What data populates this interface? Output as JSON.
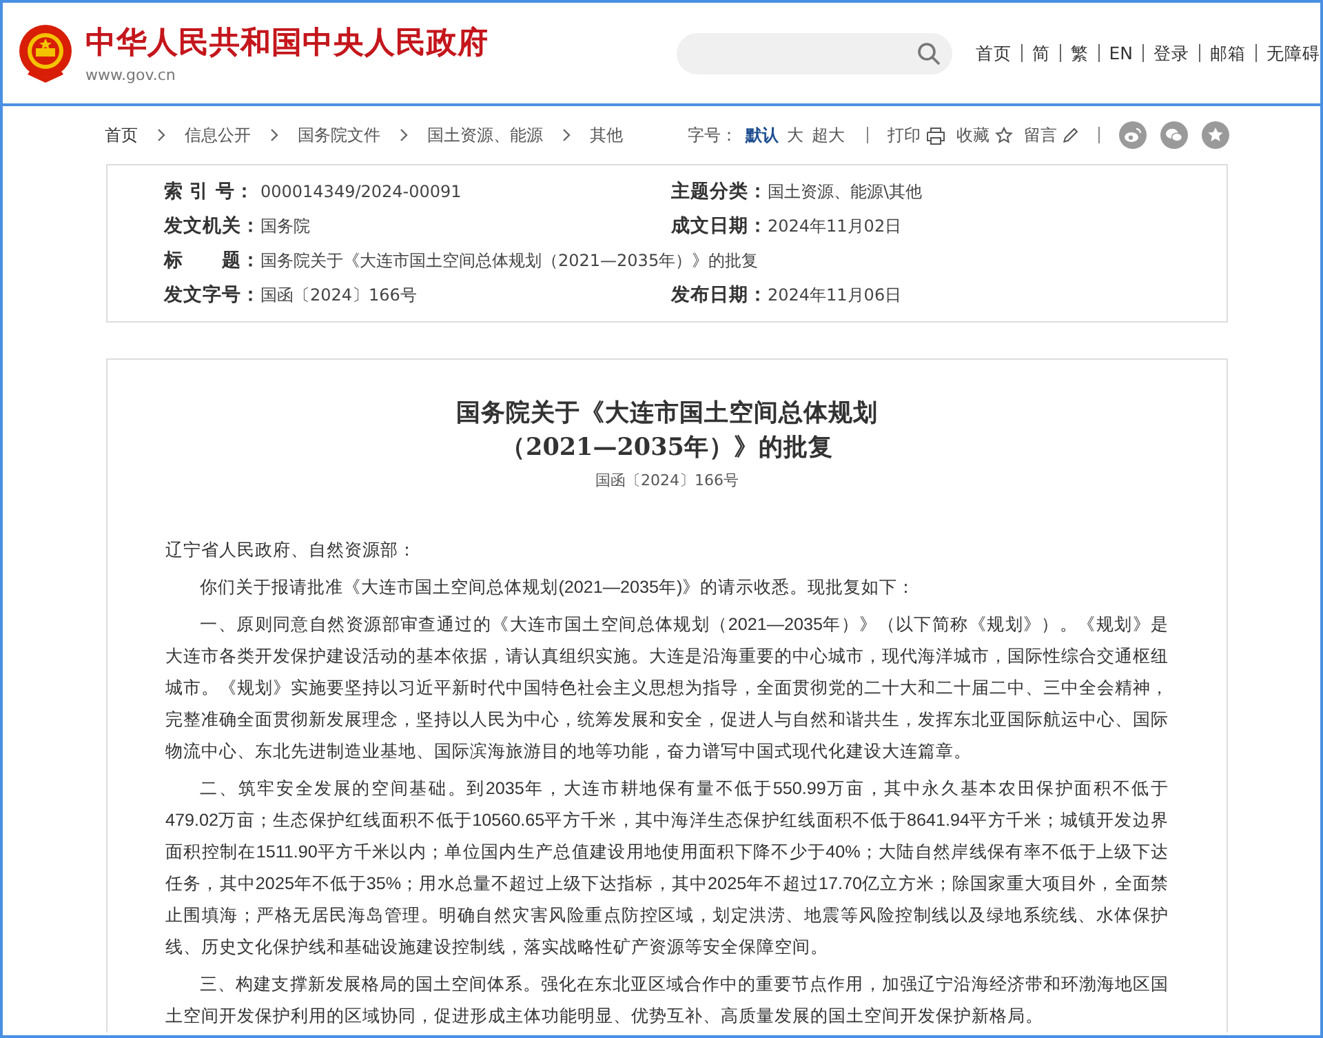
{
  "header": {
    "site_title": "中华人民共和国中央人民政府",
    "site_url": "www.gov.cn",
    "nav_links": [
      "首页",
      "简",
      "繁",
      "EN",
      "登录",
      "邮箱",
      "无障碍"
    ]
  },
  "breadcrumb": [
    "首页",
    "信息公开",
    "国务院文件",
    "国土资源、能源",
    "其他"
  ],
  "font_size": {
    "label": "字号：",
    "options": [
      {
        "label": "默认",
        "selected": true
      },
      {
        "label": "大",
        "selected": false
      },
      {
        "label": "超大",
        "selected": false
      }
    ]
  },
  "tools": [
    {
      "label": "打印",
      "kind": "print"
    },
    {
      "label": "收藏",
      "kind": "favorite"
    },
    {
      "label": "留言",
      "kind": "comment"
    }
  ],
  "share": [
    {
      "kind": "weibo"
    },
    {
      "kind": "wechat"
    },
    {
      "kind": "star"
    }
  ],
  "metadata": [
    [
      {
        "label": "索 引 号：",
        "value": "000014349/2024-00091"
      },
      {
        "label": "主题分类：",
        "value": "国土资源、能源\\其他"
      }
    ],
    [
      {
        "label": "发文机关：",
        "value": "国务院"
      },
      {
        "label": "成文日期：",
        "value": "2024年11月02日"
      }
    ],
    [
      {
        "label": "标　　题：",
        "value": "国务院关于《大连市国土空间总体规划（2021—2035年）》的批复"
      }
    ],
    [
      {
        "label": "发文字号：",
        "value": "国函〔2024〕166号"
      },
      {
        "label": "发布日期：",
        "value": "2024年11月06日"
      }
    ]
  ],
  "article": {
    "title_lines": [
      "国务院关于《大连市国土空间总体规划",
      "（2021—2035年）》的批复"
    ],
    "doc_number": "国函〔2024〕166号",
    "paragraphs": [
      {
        "text": "辽宁省人民政府、自然资源部：",
        "indent": false
      },
      {
        "text": "你们关于报请批准《大连市国土空间总体规划(2021—2035年)》的请示收悉。现批复如下：",
        "indent": true
      },
      {
        "text": "一、原则同意自然资源部审查通过的《大连市国土空间总体规划（2021—2035年）》（以下简称《规划》）。《规划》是大连市各类开发保护建设活动的基本依据，请认真组织实施。大连是沿海重要的中心城市，现代海洋城市，国际性综合交通枢纽城市。《规划》实施要坚持以习近平新时代中国特色社会主义思想为指导，全面贯彻党的二十大和二十届二中、三中全会精神，完整准确全面贯彻新发展理念，坚持以人民为中心，统筹发展和安全，促进人与自然和谐共生，发挥东北亚国际航运中心、国际物流中心、东北先进制造业基地、国际滨海旅游目的地等功能，奋力谱写中国式现代化建设大连篇章。",
        "indent": true
      },
      {
        "text": "二、筑牢安全发展的空间基础。到2035年，大连市耕地保有量不低于550.99万亩，其中永久基本农田保护面积不低于479.02万亩；生态保护红线面积不低于10560.65平方千米，其中海洋生态保护红线面积不低于8641.94平方千米；城镇开发边界面积控制在1511.90平方千米以内；单位国内生产总值建设用地使用面积下降不少于40%；大陆自然岸线保有率不低于上级下达任务，其中2025年不低于35%；用水总量不超过上级下达指标，其中2025年不超过17.70亿立方米；除国家重大项目外，全面禁止围填海；严格无居民海岛管理。明确自然灾害风险重点防控区域，划定洪涝、地震等风险控制线以及绿地系统线、水体保护线、历史文化保护线和基础设施建设控制线，落实战略性矿产资源等安全保障空间。",
        "indent": true
      },
      {
        "text": "三、构建支撑新发展格局的国土空间体系。强化在东北亚区域合作中的重要节点作用，加强辽宁沿海经济带和环渤海地区国土空间开发保护利用的区域协同，促进形成主体功能明显、优势互补、高质量发展的国土空间开发保护新格局。",
        "indent": true
      }
    ]
  }
}
